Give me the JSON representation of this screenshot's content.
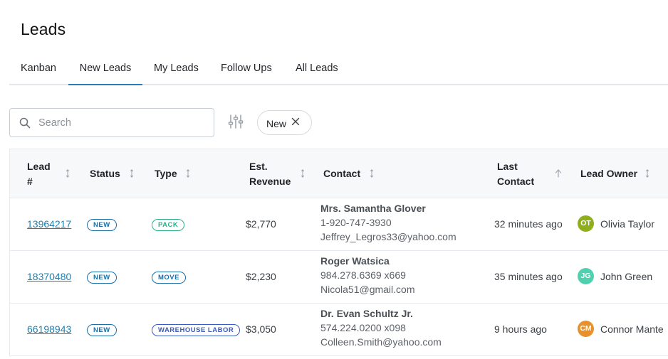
{
  "page": {
    "title": "Leads"
  },
  "tabs": [
    {
      "label": "Kanban",
      "active": false
    },
    {
      "label": "New Leads",
      "active": true
    },
    {
      "label": "My Leads",
      "active": false
    },
    {
      "label": "Follow Ups",
      "active": false
    },
    {
      "label": "All Leads",
      "active": false
    }
  ],
  "search": {
    "placeholder": "Search",
    "value": ""
  },
  "filter_chip": {
    "label": "New"
  },
  "table": {
    "columns": {
      "lead": [
        "Lead",
        "#"
      ],
      "status": "Status",
      "type": "Type",
      "revenue": [
        "Est.",
        "Revenue"
      ],
      "contact": "Contact",
      "last_contact": [
        "Last",
        "Contact"
      ],
      "owner": "Lead Owner"
    },
    "rows": [
      {
        "lead_id": "13964217",
        "status": "NEW",
        "type": "PACK",
        "revenue": "$2,770",
        "contact_name": "Mrs. Samantha Glover",
        "phone": "1-920-747-3930",
        "email": "Jeffrey_Legros33@yahoo.com",
        "last_contact": "32 minutes ago",
        "owner_initials": "OT",
        "owner_name": "Olivia Taylor"
      },
      {
        "lead_id": "18370480",
        "status": "NEW",
        "type": "MOVE",
        "revenue": "$2,230",
        "contact_name": "Roger Watsica",
        "phone": "984.278.6369 x669",
        "email": "Nicola51@gmail.com",
        "last_contact": "35 minutes ago",
        "owner_initials": "JG",
        "owner_name": "John Green"
      },
      {
        "lead_id": "66198943",
        "status": "NEW",
        "type": "WAREHOUSE LABOR",
        "revenue": "$3,050",
        "contact_name": "Dr. Evan Schultz Jr.",
        "phone": "574.224.0200 x098",
        "email": "Colleen.Smith@yahoo.com",
        "last_contact": "9 hours ago",
        "owner_initials": "CM",
        "owner_name": "Connor Mante"
      }
    ]
  },
  "colors": {
    "accent": "#2b7bb9",
    "link": "#1a82b5",
    "status_new": "#1a6fa8",
    "type_pack": "#2bb08a",
    "type_move": "#1a6fa8",
    "type_warehouse": "#3a5bbf",
    "avatar_ot": "#8fae1b",
    "avatar_jg": "#4fd1b0",
    "avatar_cm": "#e8902b"
  }
}
